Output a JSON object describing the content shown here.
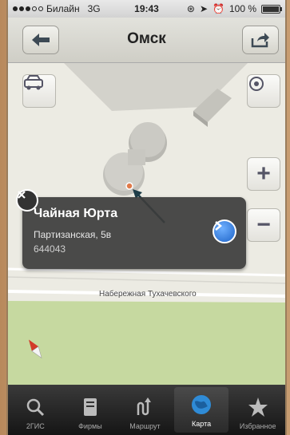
{
  "statusbar": {
    "carrier": "Билайн",
    "network": "3G",
    "time": "19:43",
    "battery": "100 %"
  },
  "navbar": {
    "title": "Омск",
    "back_icon": "back-arrow-icon",
    "share_icon": "share-icon"
  },
  "map": {
    "street_label": "Набережная Тухачевского",
    "controls": {
      "traffic_icon": "car-traffic-icon",
      "locate_icon": "locate-icon",
      "zoom_in": "+",
      "zoom_out": "−"
    },
    "callout": {
      "title": "Чайная Юрта",
      "address": "Партизанская, 5в",
      "postcode": "644043"
    }
  },
  "tabbar": {
    "items": [
      {
        "label": "2ГИС",
        "icon": "search-icon"
      },
      {
        "label": "Фирмы",
        "icon": "book-icon"
      },
      {
        "label": "Маршрут",
        "icon": "route-icon"
      },
      {
        "label": "Карта",
        "icon": "globe-icon",
        "active": true
      },
      {
        "label": "Избранное",
        "icon": "star-icon"
      }
    ]
  },
  "colors": {
    "park": "#c6d9a0",
    "building": "#c9c8c2",
    "callout_bg": "#3c3c3c",
    "tab_active_icon": "#2f8bd6"
  }
}
